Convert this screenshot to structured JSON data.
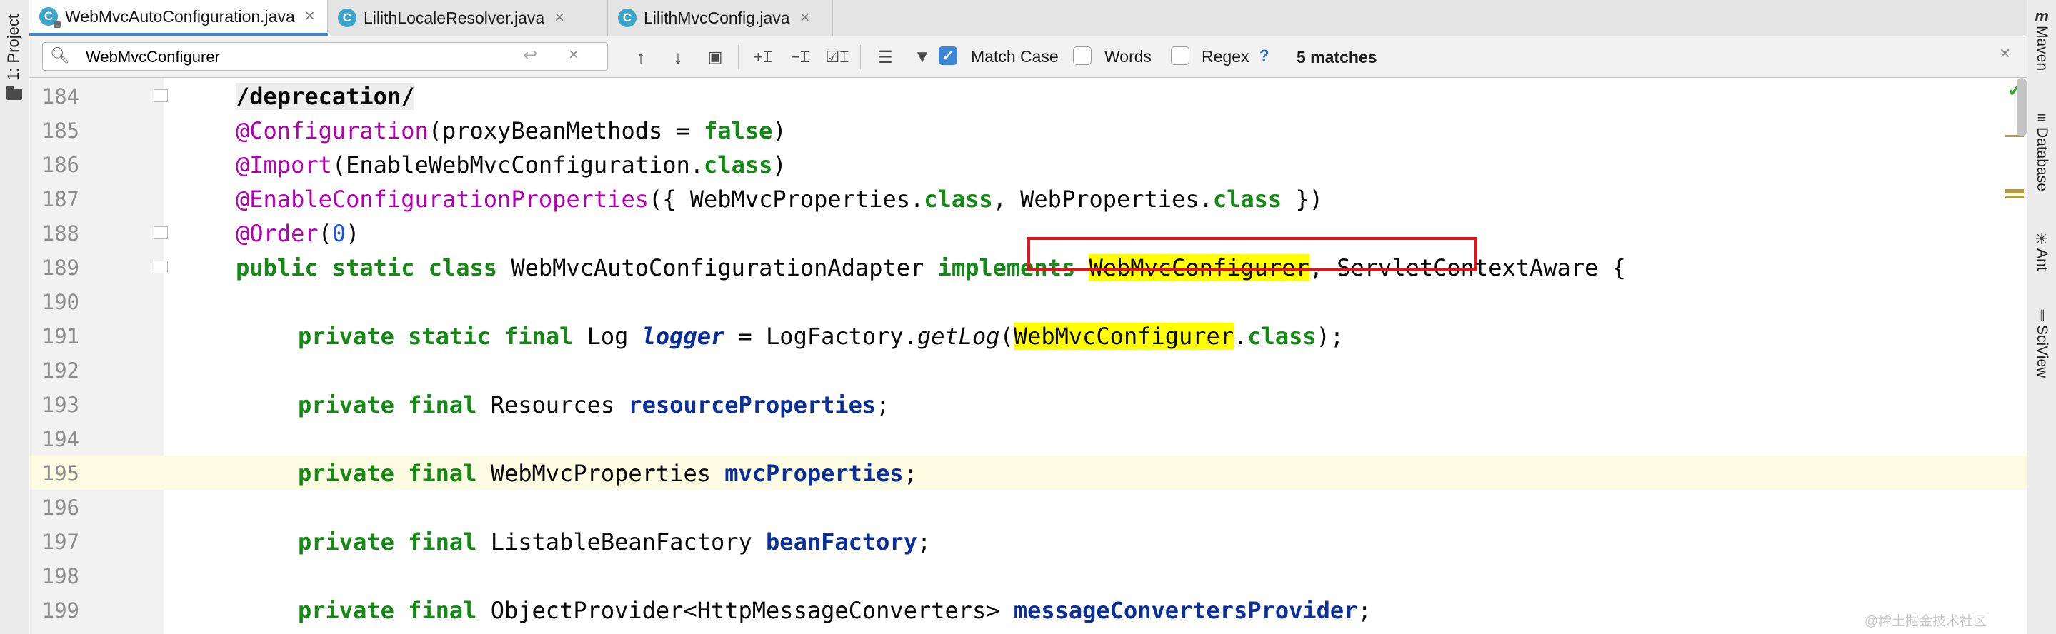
{
  "left_tool_window": {
    "label": "1: Project"
  },
  "right_tool_windows": [
    {
      "label": "Maven",
      "icon": "maven-icon"
    },
    {
      "label": "Database",
      "icon": "database-icon"
    },
    {
      "label": "Ant",
      "icon": "ant-icon"
    },
    {
      "label": "SciView",
      "icon": "sciview-icon"
    }
  ],
  "tabs": [
    {
      "label": "WebMvcAutoConfiguration.java",
      "icon": "class-icon",
      "active": true
    },
    {
      "label": "LilithLocaleResolver.java",
      "icon": "class-icon",
      "active": false
    },
    {
      "label": "LilithMvcConfig.java",
      "icon": "class-icon",
      "active": false
    }
  ],
  "find": {
    "query": "WebMvcConfigurer",
    "options": [
      {
        "label": "Match Case",
        "checked": true
      },
      {
        "label": "Words",
        "checked": false
      },
      {
        "label": "Regex",
        "checked": false
      }
    ],
    "help": "?",
    "matches": "5 matches"
  },
  "editor": {
    "current_line": 195,
    "lines": [
      {
        "num": "184",
        "fold": true,
        "tokens": [
          [
            "depr",
            "/deprecation/"
          ]
        ]
      },
      {
        "num": "185",
        "fold": false,
        "tokens": [
          [
            "ann",
            "@Configuration"
          ],
          [
            "",
            "(proxyBeanMethods = "
          ],
          [
            "kw",
            "false"
          ],
          [
            "",
            ")"
          ]
        ]
      },
      {
        "num": "186",
        "fold": false,
        "tokens": [
          [
            "ann",
            "@Import"
          ],
          [
            "",
            "(EnableWebMvcConfiguration."
          ],
          [
            "kw",
            "class"
          ],
          [
            "",
            ")"
          ]
        ]
      },
      {
        "num": "187",
        "fold": false,
        "tokens": [
          [
            "ann",
            "@EnableConfigurationProperties"
          ],
          [
            "",
            "({ WebMvcProperties."
          ],
          [
            "kw",
            "class"
          ],
          [
            "",
            ", WebProperties."
          ],
          [
            "kw",
            "class"
          ],
          [
            "",
            " })"
          ]
        ]
      },
      {
        "num": "188",
        "fold": true,
        "tokens": [
          [
            "ann",
            "@Order"
          ],
          [
            "",
            "("
          ],
          [
            "num",
            "0"
          ],
          [
            "",
            ")"
          ]
        ]
      },
      {
        "num": "189",
        "fold": true,
        "tokens": [
          [
            "kw",
            "public static class"
          ],
          [
            "",
            " WebMvcAutoConfigurationAdapter "
          ],
          [
            "kw",
            "implements"
          ],
          [
            "",
            " "
          ],
          [
            "hl",
            "WebMvcConfigurer"
          ],
          [
            "",
            ", ServletContextAware {"
          ]
        ]
      },
      {
        "num": "190",
        "fold": false,
        "tokens": []
      },
      {
        "num": "191",
        "fold": false,
        "tokens": [
          [
            "kw",
            "private static final"
          ],
          [
            "",
            " Log "
          ],
          [
            "sfld",
            "logger"
          ],
          [
            "",
            " = LogFactory."
          ],
          [
            "mcall",
            "getLog"
          ],
          [
            "",
            "("
          ],
          [
            "hl",
            "WebMvcConfigurer"
          ],
          [
            "",
            "."
          ],
          [
            "kw",
            "class"
          ],
          [
            "",
            ");"
          ]
        ]
      },
      {
        "num": "192",
        "fold": false,
        "tokens": []
      },
      {
        "num": "193",
        "fold": false,
        "tokens": [
          [
            "kw",
            "private final"
          ],
          [
            "",
            " Resources "
          ],
          [
            "fld",
            "resourceProperties"
          ],
          [
            "",
            ";"
          ]
        ]
      },
      {
        "num": "194",
        "fold": false,
        "tokens": []
      },
      {
        "num": "195",
        "fold": false,
        "tokens": [
          [
            "kw",
            "private final"
          ],
          [
            "",
            " WebMvcProperties "
          ],
          [
            "fld",
            "mvcProperties"
          ],
          [
            "",
            ";"
          ]
        ]
      },
      {
        "num": "196",
        "fold": false,
        "tokens": []
      },
      {
        "num": "197",
        "fold": false,
        "tokens": [
          [
            "kw",
            "private final"
          ],
          [
            "",
            " ListableBeanFactory "
          ],
          [
            "fld",
            "beanFactory"
          ],
          [
            "",
            ";"
          ]
        ]
      },
      {
        "num": "198",
        "fold": false,
        "tokens": []
      },
      {
        "num": "199",
        "fold": false,
        "tokens": [
          [
            "kw",
            "private final"
          ],
          [
            "",
            " ObjectProvider<HttpMessageConverters> "
          ],
          [
            "fld",
            "messageConvertersProvider"
          ],
          [
            "",
            ";"
          ]
        ]
      }
    ]
  },
  "watermark": "@稀土掘金技术社区",
  "colors": {
    "keyword": "#138a13",
    "annotation": "#b200b2",
    "field": "#0a2f9b",
    "search_highlight": "#ffff00",
    "annotation_box": "#e0141c",
    "current_line": "#fefbe3",
    "tab_accent": "#4083c9"
  }
}
